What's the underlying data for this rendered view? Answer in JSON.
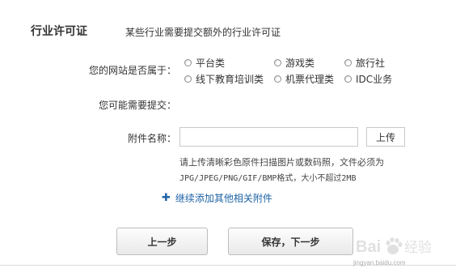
{
  "section": {
    "title": "行业许可证",
    "description": "某些行业需要提交额外的行业许可证"
  },
  "site_type": {
    "label": "您的网站是否属于：",
    "options": [
      "平台类",
      "游戏类",
      "旅行社",
      "线下教育培训类",
      "机票代理类",
      "IDC业务"
    ]
  },
  "submit_note": {
    "label": "您可能需要提交："
  },
  "attachment": {
    "label": "附件名称：",
    "value": "",
    "upload_label": "上传",
    "hint_line1": "请上传清晰彩色原件扫描图片或数码照，文件必须为",
    "hint_line2": "JPG/JPEG/PNG/GIF/BMP格式，大小不超过2MB"
  },
  "add_more": {
    "icon": "plus-icon",
    "label": "继续添加其他相关附件"
  },
  "actions": {
    "prev_label": "上一步",
    "next_label": "保存，下一步"
  },
  "watermark": {
    "brand": "Baidu经验",
    "url": "jingyan.baidu.com"
  },
  "colors": {
    "link": "#1f63a6",
    "text": "#333333",
    "border": "#c9c9c9"
  }
}
